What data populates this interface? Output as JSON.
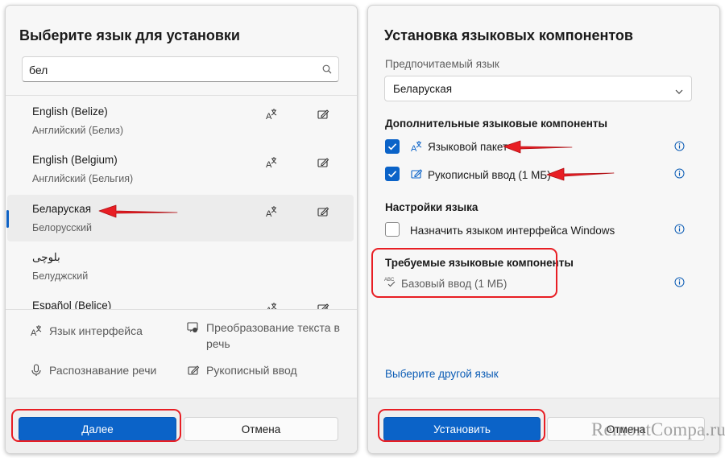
{
  "left_dialog": {
    "title": "Выберите язык для установки",
    "search": {
      "value": "бел",
      "placeholder": ""
    },
    "languages": [
      {
        "name": "English (Belize)",
        "subtitle": "Английский (Белиз)",
        "icons": [
          "language-pack-icon",
          "handwriting-icon"
        ],
        "selected": false
      },
      {
        "name": "English (Belgium)",
        "subtitle": "Английский (Бельгия)",
        "icons": [
          "language-pack-icon",
          "handwriting-icon"
        ],
        "selected": false
      },
      {
        "name": "Беларуская",
        "subtitle": "Белорусский",
        "icons": [
          "language-pack-icon",
          "handwriting-icon"
        ],
        "selected": true
      },
      {
        "name": "بلوچی",
        "subtitle": "Белуджский",
        "icons": [],
        "selected": false
      },
      {
        "name": "Español (Belice)",
        "subtitle": "",
        "icons": [
          "language-pack-icon",
          "handwriting-icon"
        ],
        "selected": false
      }
    ],
    "features": [
      {
        "icon": "display-language-icon",
        "label": "Язык интерфейса"
      },
      {
        "icon": "text-to-speech-icon",
        "label": "Преобразование текста в речь"
      },
      {
        "icon": "microphone-icon",
        "label": "Распознавание речи"
      },
      {
        "icon": "handwriting-icon",
        "label": "Рукописный ввод"
      }
    ],
    "buttons": {
      "next": "Далее",
      "cancel": "Отмена"
    }
  },
  "right_dialog": {
    "title": "Установка языковых компонентов",
    "preferred_label": "Предпочитаемый язык",
    "preferred_value": "Беларуская",
    "optional_heading": "Дополнительные языковые компоненты",
    "optional": [
      {
        "label": "Языковой пакет",
        "checked": true,
        "icon": "language-pack-icon"
      },
      {
        "label": "Рукописный ввод (1 МБ)",
        "checked": true,
        "icon": "handwriting-icon"
      }
    ],
    "settings_heading": "Настройки языка",
    "settings": [
      {
        "label": "Назначить языком интерфейса Windows",
        "checked": false
      }
    ],
    "required_heading": "Требуемые языковые компоненты",
    "required": [
      {
        "label": "Базовый ввод (1 МБ)",
        "icon": "abc-spellcheck-icon"
      }
    ],
    "link": "Выберите другой язык",
    "buttons": {
      "install": "Установить",
      "cancel": "Отмена"
    }
  },
  "watermark": "RemontCompa.ru",
  "colors": {
    "accent": "#0b63c8",
    "annotation_red": "#e81e24",
    "dialog_bg": "#f7f7f7"
  }
}
